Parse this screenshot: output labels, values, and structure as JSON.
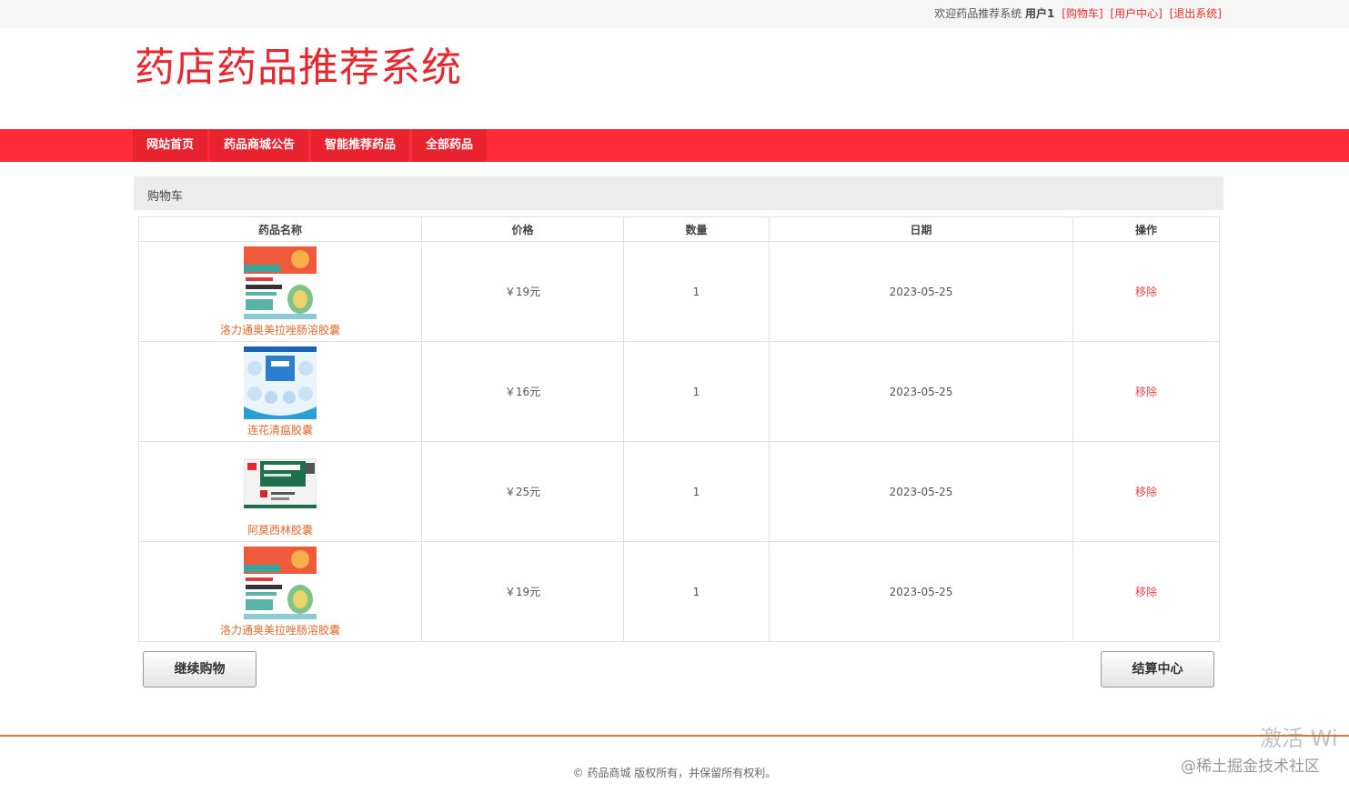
{
  "topbar": {
    "welcome": "欢迎药品推荐系统",
    "user": "用户1",
    "links": [
      "[购物车]",
      "[用户中心]",
      "[退出系统]"
    ]
  },
  "header": {
    "title": "药店药品推荐系统"
  },
  "nav": {
    "items": [
      "网站首页",
      "药品商城公告",
      "智能推荐药品",
      "全部药品"
    ]
  },
  "panel": {
    "title": "购物车"
  },
  "table": {
    "columns": [
      "药品名称",
      "价格",
      "数量",
      "日期",
      "操作"
    ],
    "rows": [
      {
        "name": "洛力通奥美拉唑肠溶胶囊",
        "price": "￥19元",
        "qty": "1",
        "date": "2023-05-25",
        "action": "移除",
        "thumb": "omeprazole"
      },
      {
        "name": "连花清瘟胶囊",
        "price": "￥16元",
        "qty": "1",
        "date": "2023-05-25",
        "action": "移除",
        "thumb": "lianhua"
      },
      {
        "name": "阿莫西林胶囊",
        "price": "￥25元",
        "qty": "1",
        "date": "2023-05-25",
        "action": "移除",
        "thumb": "amoxicillin"
      },
      {
        "name": "洛力通奥美拉唑肠溶胶囊",
        "price": "￥19元",
        "qty": "1",
        "date": "2023-05-25",
        "action": "移除",
        "thumb": "omeprazole"
      }
    ]
  },
  "buttons": {
    "continue": "继续购物",
    "checkout": "结算中心"
  },
  "footer": {
    "text": "© 药品商城 版权所有，并保留所有权利。"
  },
  "watermark": {
    "activate": "激活 Wi",
    "site": "@稀土掘金技术社区"
  },
  "colors": {
    "brand_red": "#e8262d",
    "nav_red": "#ff2b38",
    "link_orange": "#e06a2a",
    "footer_line": "#e07a2a"
  }
}
